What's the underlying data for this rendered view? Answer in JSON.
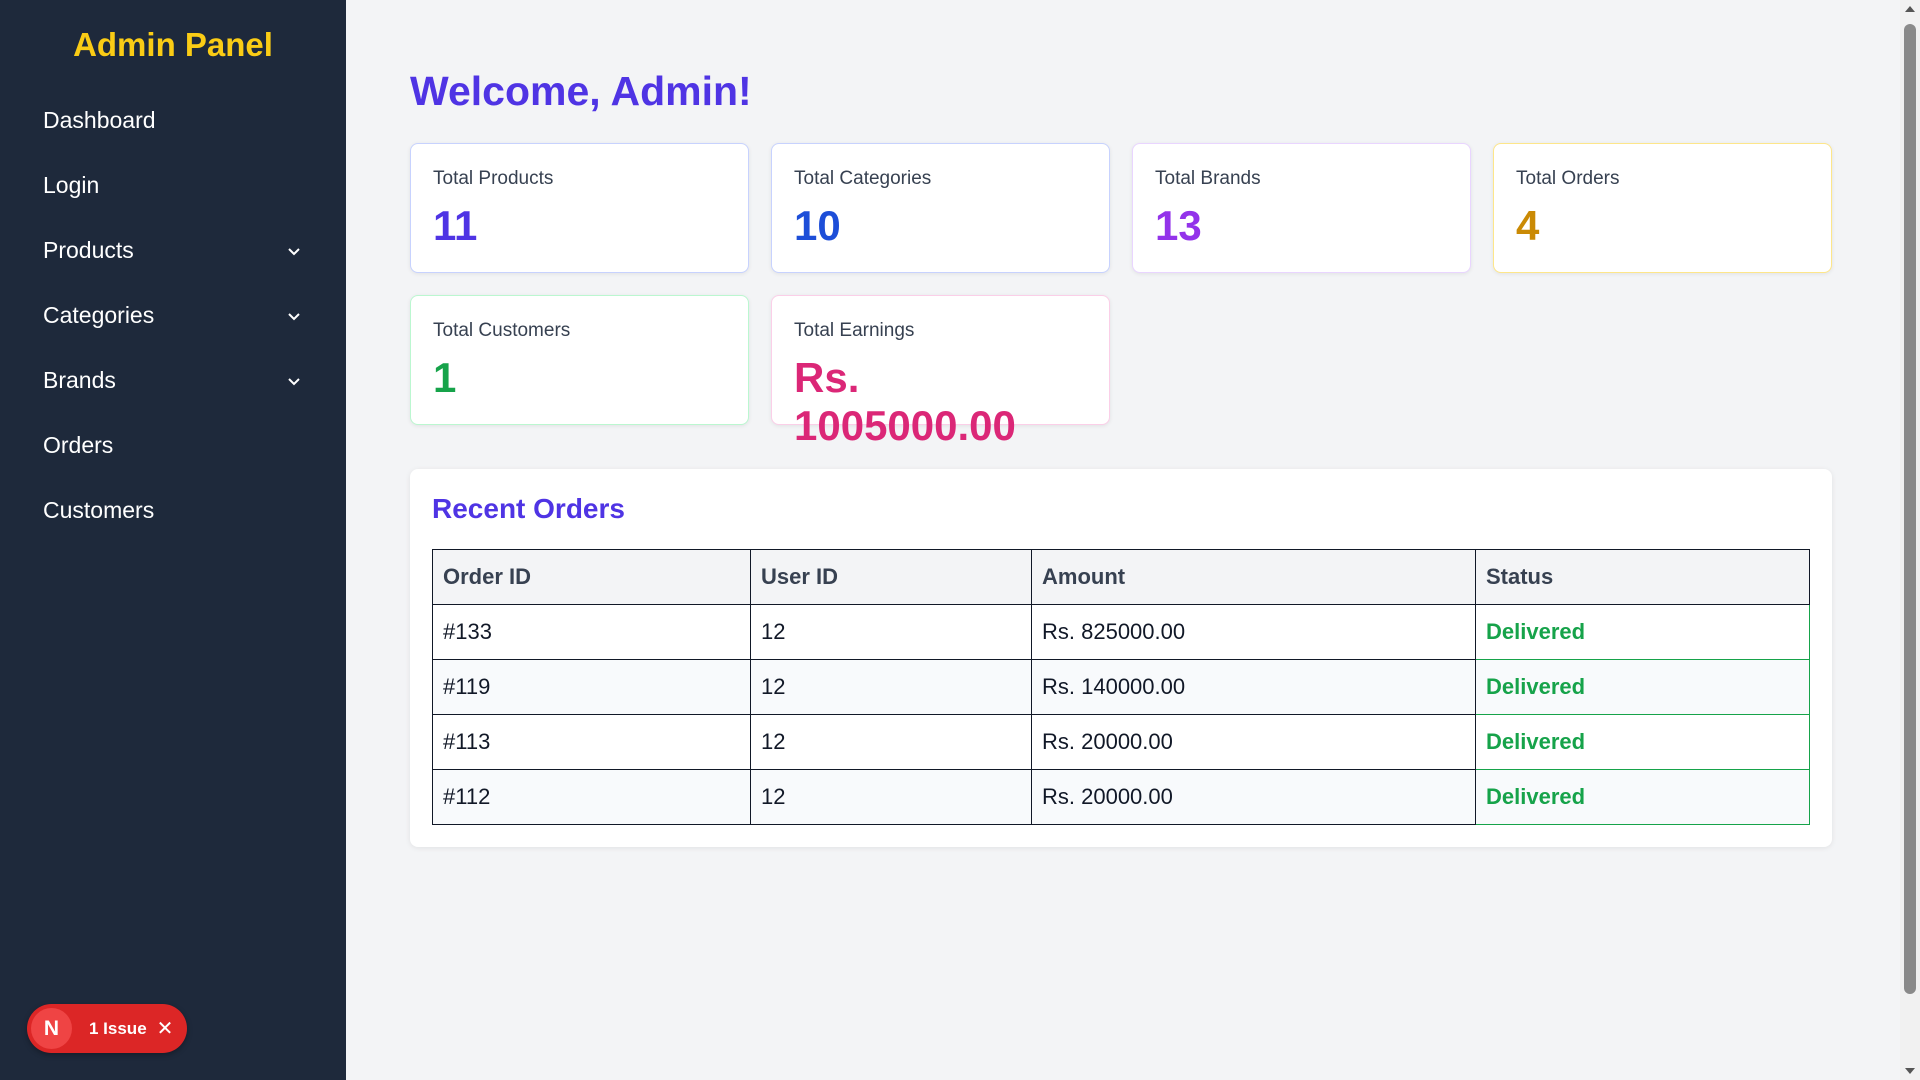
{
  "sidebar": {
    "title": "Admin Panel",
    "items": [
      {
        "label": "Dashboard",
        "has_dropdown": false
      },
      {
        "label": "Login",
        "has_dropdown": false
      },
      {
        "label": "Products",
        "has_dropdown": true
      },
      {
        "label": "Categories",
        "has_dropdown": true
      },
      {
        "label": "Brands",
        "has_dropdown": true
      },
      {
        "label": "Orders",
        "has_dropdown": false
      },
      {
        "label": "Customers",
        "has_dropdown": false
      }
    ]
  },
  "issue_badge": {
    "logo": "N",
    "label": "1 Issue",
    "close_icon": "close-icon"
  },
  "main": {
    "welcome": "Welcome, Admin!",
    "stats": [
      {
        "label": "Total Products",
        "value": "11",
        "color": "#4f34e4"
      },
      {
        "label": "Total Categories",
        "value": "10",
        "color": "#1d4ed8"
      },
      {
        "label": "Total Brands",
        "value": "13",
        "color": "#9333ea"
      },
      {
        "label": "Total Orders",
        "value": "4",
        "color": "#ca8a04"
      },
      {
        "label": "Total Customers",
        "value": "1",
        "color": "#16a34a"
      },
      {
        "label": "Total Earnings",
        "value": "Rs. 1005000.00",
        "color": "#db2777"
      }
    ],
    "recent_orders": {
      "title": "Recent Orders",
      "columns": [
        "Order ID",
        "User ID",
        "Amount",
        "Status"
      ],
      "rows": [
        {
          "order_id": "#133",
          "user_id": "12",
          "amount": "Rs. 825000.00",
          "status": "Delivered"
        },
        {
          "order_id": "#119",
          "user_id": "12",
          "amount": "Rs. 140000.00",
          "status": "Delivered"
        },
        {
          "order_id": "#113",
          "user_id": "12",
          "amount": "Rs. 20000.00",
          "status": "Delivered"
        },
        {
          "order_id": "#112",
          "user_id": "12",
          "amount": "Rs. 20000.00",
          "status": "Delivered"
        }
      ]
    }
  },
  "colors": {
    "sidebar_bg": "#1e293b",
    "title_yellow": "#facc15",
    "accent": "#4f34e4",
    "status_green": "#16a34a",
    "badge_red": "#dc2626"
  }
}
